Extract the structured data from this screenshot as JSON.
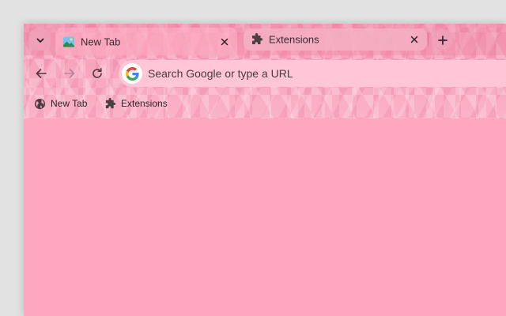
{
  "tabs": [
    {
      "title": "New Tab",
      "icon": "image-favicon-icon",
      "active": true
    },
    {
      "title": "Extensions",
      "icon": "puzzle-icon",
      "active": false
    }
  ],
  "omnibox": {
    "placeholder": "Search Google or type a URL"
  },
  "bookmarks": [
    {
      "label": "New Tab",
      "icon": "globe-icon"
    },
    {
      "label": "Extensions",
      "icon": "puzzle-icon"
    }
  ],
  "colors": {
    "content_bg": "#ffa7bf",
    "toolbar_bg": "#f7a2ba",
    "omnibox_bg": "#ffc6d7"
  }
}
